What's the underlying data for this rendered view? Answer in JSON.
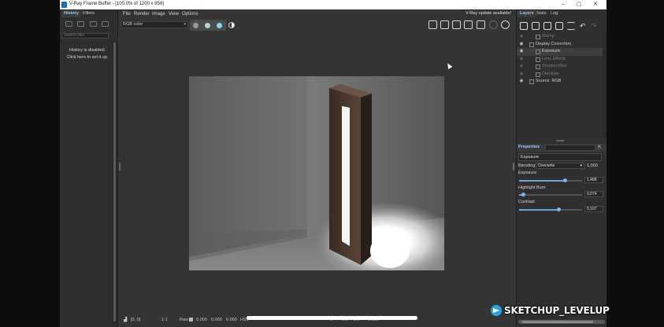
{
  "window": {
    "title": "V-Ray Frame Buffer - [100.0% of 1200 x 856]",
    "controls": [
      "–",
      "▢",
      "✕"
    ]
  },
  "left_panel": {
    "tabs": [
      "History",
      "Filters"
    ],
    "search_placeholder": "Search filter",
    "message_line1": "History is disabled.",
    "message_line2": "Click here to set it up."
  },
  "menu": [
    "File",
    "Render",
    "Image",
    "View",
    "Options"
  ],
  "toolbar": {
    "channel": "RGB color",
    "update_notice": "V-Ray update available!"
  },
  "right_panel": {
    "tabs": [
      "Layers",
      "Stats",
      "Log"
    ],
    "layers": [
      {
        "name": "Stamp",
        "enabled": false,
        "selected": false
      },
      {
        "name": "Display Correction",
        "enabled": true,
        "selected": false
      },
      {
        "name": "Exposure",
        "enabled": true,
        "selected": true
      },
      {
        "name": "Lens Effects",
        "enabled": false,
        "selected": false
      },
      {
        "name": "Sharpen/Blur",
        "enabled": false,
        "selected": false
      },
      {
        "name": "Denoiser",
        "enabled": false,
        "selected": false
      },
      {
        "name": "Source: RGB",
        "enabled": true,
        "selected": false
      }
    ],
    "properties": {
      "title": "Properties",
      "layer_name": "Exposure",
      "blending_label": "Blending",
      "blending_mode": "Overwrite",
      "blending_value": "1,000",
      "exposure_label": "Exposure",
      "exposure_value": "1,468",
      "exposure_level": 0.73,
      "highlight_label": "Highlight Burn",
      "highlight_value": "0,074",
      "highlight_level": 0.07,
      "contrast_label": "Contrast",
      "contrast_value": "0,167",
      "contrast_level": 0.63
    }
  },
  "status_bar": {
    "coords": "[0, 0]",
    "zoom": "1:1",
    "raw_label": "Raw",
    "v1": "0.000",
    "v2": "0.000",
    "v3": "0.000",
    "mode": "HSV",
    "v4": "0",
    "v5": "0.0",
    "v6": "0.0",
    "v7": "0.000"
  },
  "watermark": "SKETCHUP_LEVELUP",
  "colors": {
    "accent": "#9cc8ff",
    "panel": "#2e2e2e",
    "background": "#343434"
  }
}
